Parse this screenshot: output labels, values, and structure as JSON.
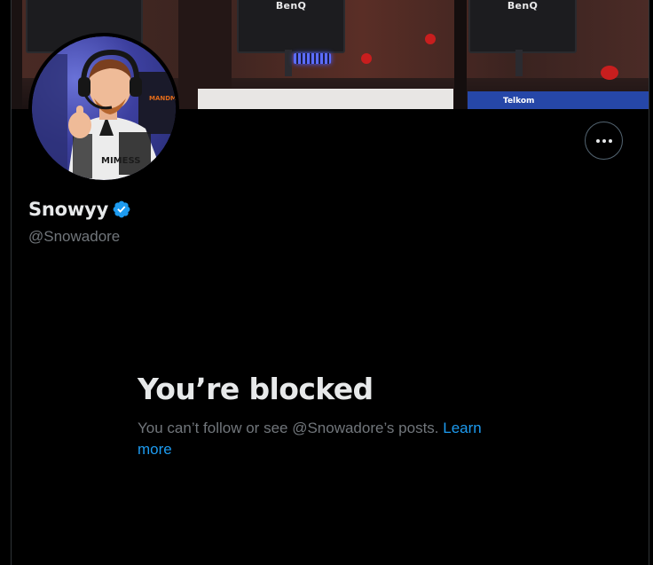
{
  "banner": {
    "monitor_brand_left": "BenQ",
    "monitor_brand_right": "BenQ",
    "sponsor_text": "Telkom"
  },
  "profile": {
    "display_name": "Snowyy",
    "handle": "@Snowadore",
    "verified": true,
    "verified_color": "#1d9bf0",
    "avatar_jersey_text": "MIMESS",
    "avatar_brand_text": "MANDM"
  },
  "actions": {
    "more_label": "More",
    "more_icon": "more-horizontal-icon"
  },
  "blocked": {
    "title": "You’re blocked",
    "message": "You can’t follow or see @Snowadore’s posts. ",
    "link_label": "Learn more"
  },
  "theme": {
    "background": "#000000",
    "text_primary": "#e7e9ea",
    "text_secondary": "#71767b",
    "accent": "#1d9bf0",
    "border": "#2f3336"
  }
}
